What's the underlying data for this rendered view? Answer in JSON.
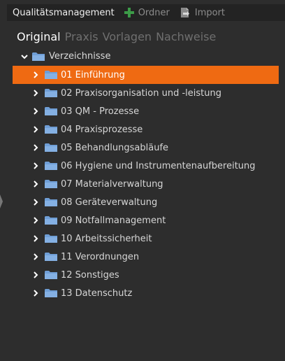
{
  "toolbar": {
    "title": "Qualitätsmanagement",
    "ordner_label": "Ordner",
    "import_label": "Import"
  },
  "tabs": [
    {
      "label": "Original",
      "active": true
    },
    {
      "label": "Praxis",
      "active": false
    },
    {
      "label": "Vorlagen",
      "active": false
    },
    {
      "label": "Nachweise",
      "active": false
    }
  ],
  "tree": {
    "root_label": "Verzeichnisse",
    "items": [
      {
        "label": "01 Einführung",
        "selected": true
      },
      {
        "label": "02 Praxisorganisation und -leistung"
      },
      {
        "label": "03 QM - Prozesse"
      },
      {
        "label": "04 Praxisprozesse"
      },
      {
        "label": "05 Behandlungsabläufe"
      },
      {
        "label": "06 Hygiene und Instrumentenaufbereitung"
      },
      {
        "label": "07 Materialverwaltung"
      },
      {
        "label": "08 Geräteverwaltung"
      },
      {
        "label": "09 Notfallmanagement"
      },
      {
        "label": "10 Arbeitssicherheit"
      },
      {
        "label": "11 Verordnungen"
      },
      {
        "label": "12 Sonstiges"
      },
      {
        "label": "13 Datenschutz"
      }
    ]
  },
  "colors": {
    "background": "#2d2d2d",
    "toolbar": "#232323",
    "selected": "#ef6a12",
    "folder": "#6f9ed6",
    "ordner_icon": "#3c9b48"
  },
  "icons": {
    "ordner": "plus-icon",
    "import": "import-icon",
    "folder": "folder-icon",
    "expanded": "chevron-down-icon",
    "collapsed": "chevron-right-icon"
  }
}
